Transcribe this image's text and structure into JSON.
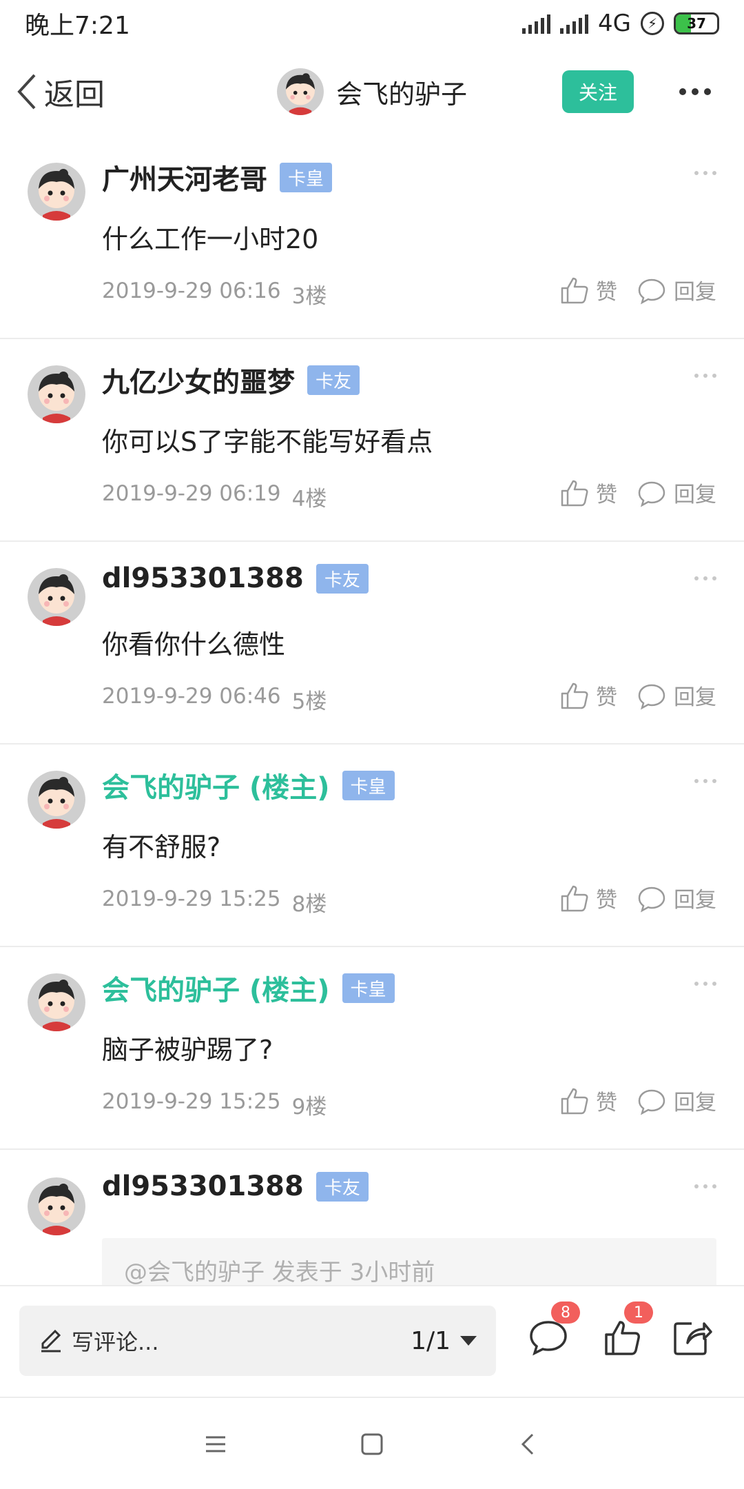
{
  "status_bar": {
    "time": "晚上7:21",
    "network": "4G",
    "battery": "37",
    "battery_level": 0.37
  },
  "nav": {
    "back_label": "返回",
    "title": "会飞的驴子",
    "follow_label": "关注"
  },
  "comments": [
    {
      "name": "广州天河老哥",
      "badge": "卡皇",
      "text": "什么工作一小时20",
      "time": "2019-9-29 06:16",
      "floor": "3楼",
      "like": "赞",
      "reply": "回复",
      "owner": false
    },
    {
      "name": "九亿少女的噩梦",
      "badge": "卡友",
      "text": "你可以S了字能不能写好看点",
      "time": "2019-9-29 06:19",
      "floor": "4楼",
      "like": "赞",
      "reply": "回复",
      "owner": false
    },
    {
      "name": "dl953301388",
      "badge": "卡友",
      "text": "你看你什么德性",
      "time": "2019-9-29 06:46",
      "floor": "5楼",
      "like": "赞",
      "reply": "回复",
      "owner": false
    },
    {
      "name": "会飞的驴子 (楼主)",
      "badge": "卡皇",
      "text": "有不舒服?",
      "time": "2019-9-29 15:25",
      "floor": "8楼",
      "like": "赞",
      "reply": "回复",
      "owner": true
    },
    {
      "name": "会飞的驴子 (楼主)",
      "badge": "卡皇",
      "text": "脑子被驴踢了?",
      "time": "2019-9-29 15:25",
      "floor": "9楼",
      "like": "赞",
      "reply": "回复",
      "owner": true
    }
  ],
  "partial_comment": {
    "name": "dl953301388",
    "badge": "卡友",
    "quote": "@会飞的驴子 发表于 3小时前"
  },
  "bottom_bar": {
    "input_placeholder": "写评论...",
    "page_indicator": "1/1",
    "comment_count": "8",
    "like_count": "1"
  },
  "colors": {
    "accent": "#2dbf9b",
    "badge": "#8fb5ec",
    "count_badge": "#f25f5c"
  }
}
